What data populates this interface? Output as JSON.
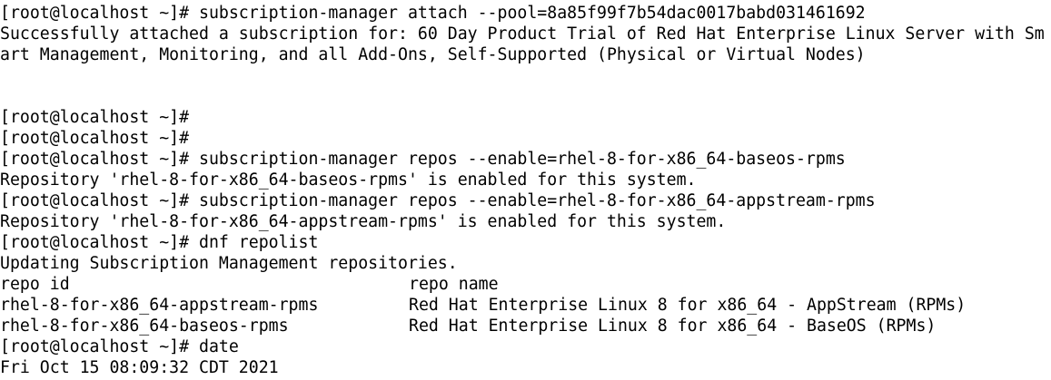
{
  "terminal": {
    "prompt": "[root@localhost ~]#",
    "lines": {
      "l1": "[root@localhost ~]# subscription-manager attach --pool=8a85f99f7b54dac0017babd031461692",
      "l2": "Successfully attached a subscription for: 60 Day Product Trial of Red Hat Enterprise Linux Server with Sm",
      "l3": "art Management, Monitoring, and all Add-Ons, Self-Supported (Physical or Virtual Nodes)",
      "l6": "[root@localhost ~]#",
      "l7": "[root@localhost ~]#",
      "l8": "[root@localhost ~]# subscription-manager repos --enable=rhel-8-for-x86_64-baseos-rpms",
      "l9": "Repository 'rhel-8-for-x86_64-baseos-rpms' is enabled for this system.",
      "l10": "[root@localhost ~]# subscription-manager repos --enable=rhel-8-for-x86_64-appstream-rpms",
      "l11": "Repository 'rhel-8-for-x86_64-appstream-rpms' is enabled for this system.",
      "l12": "[root@localhost ~]# dnf repolist",
      "l13": "Updating Subscription Management repositories.",
      "l17": "[root@localhost ~]# date",
      "l18": "Fri Oct 15 08:09:32 CDT 2021"
    },
    "repolist": {
      "header": {
        "id": "repo id",
        "name": "repo name"
      },
      "rows": [
        {
          "id": "rhel-8-for-x86_64-appstream-rpms",
          "name": "Red Hat Enterprise Linux 8 for x86_64 - AppStream (RPMs)"
        },
        {
          "id": "rhel-8-for-x86_64-baseos-rpms",
          "name": "Red Hat Enterprise Linux 8 for x86_64 - BaseOS (RPMs)"
        }
      ]
    },
    "colors": {
      "background": "#ffffff",
      "foreground": "#000000"
    }
  }
}
